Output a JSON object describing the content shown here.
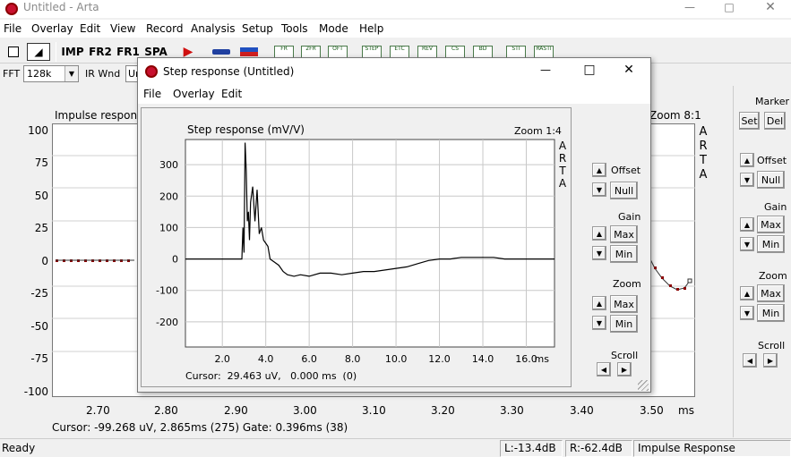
{
  "main": {
    "title": "Untitled - Arta",
    "menu": [
      "File",
      "Overlay",
      "Edit",
      "View",
      "Record",
      "Analysis",
      "Setup",
      "Tools",
      "Mode",
      "Help"
    ],
    "toolbar": {
      "imp": "IMP",
      "fr2": "FR2",
      "fr1": "FR1",
      "spa": "SPA",
      "tiny_icons": [
        "FR",
        "2FR",
        "OFT",
        "STEP",
        "ETC",
        "REV",
        "CS",
        "BD",
        "STI",
        "RASTI"
      ]
    },
    "fft_label": "FFT",
    "fft_value": "128k",
    "ir_wnd_label": "IR Wnd",
    "ir_wnd_value": "Un",
    "plot": {
      "title": "Impulse respons",
      "zoom": "Zoom 8:1",
      "arta_letters": [
        "A",
        "R",
        "T",
        "A"
      ],
      "y_ticks": [
        "100",
        "75",
        "50",
        "25",
        "0",
        "-25",
        "-50",
        "-75",
        "-100"
      ],
      "x_ticks": [
        "2.70",
        "2.80",
        "2.90",
        "3.00",
        "3.10",
        "3.20",
        "3.30",
        "3.40",
        "3.50"
      ],
      "x_unit": "ms",
      "cursor_text": "Cursor: -99.268 uV, 2.865ms (275)  Gate: 0.396ms (38)"
    },
    "right_panel": {
      "marker_label": "Marker",
      "set": "Set",
      "del": "Del",
      "offset_label": "Offset",
      "null": "Null",
      "gain_label": "Gain",
      "max": "Max",
      "min": "Min",
      "zoom_label": "Zoom",
      "zoom_max": "Max",
      "zoom_min": "Min",
      "scroll_label": "Scroll"
    },
    "status": {
      "ready": "Ready",
      "left": "L:-13.4dB",
      "right": "R:-62.4dB",
      "mode": "Impulse Response"
    }
  },
  "dialog": {
    "title": "Step response (Untitled)",
    "menu": [
      "File",
      "Overlay",
      "Edit"
    ],
    "chart_title": "Step response (mV/V)",
    "zoom": "Zoom 1:4",
    "arta_letters": [
      "A",
      "R",
      "T",
      "A"
    ],
    "cursor_text": "Cursor:  29.463 uV,   0.000 ms  (0)",
    "controls": {
      "offset_label": "Offset",
      "null": "Null",
      "gain_label": "Gain",
      "gain_max": "Max",
      "gain_min": "Min",
      "zoom_label": "Zoom",
      "zoom_max": "Max",
      "zoom_min": "Min",
      "scroll_label": "Scroll"
    }
  },
  "chart_data": [
    {
      "type": "line",
      "title": "Step response (mV/V)",
      "xlabel": "ms",
      "ylabel": "",
      "xlim": [
        0.3,
        17.3
      ],
      "ylim": [
        -280,
        380
      ],
      "x_ticks": [
        "2.0",
        "4.0",
        "6.0",
        "8.0",
        "10.0",
        "12.0",
        "14.0",
        "16.0"
      ],
      "y_ticks": [
        "300",
        "200",
        "100",
        "0",
        "-100",
        "-200"
      ],
      "grid": true,
      "series": [
        {
          "x": [
            0.3,
            2.5,
            2.9,
            2.95,
            3.0,
            3.05,
            3.1,
            3.15,
            3.2,
            3.25,
            3.3,
            3.4,
            3.5,
            3.6,
            3.7,
            3.8,
            3.9,
            4.0,
            4.1,
            4.2,
            4.4,
            4.6,
            4.8,
            5.0,
            5.3,
            5.6,
            6.0,
            6.5,
            7.0,
            7.5,
            8.0,
            8.5,
            9.0,
            9.5,
            10.0,
            10.5,
            11.0,
            11.5,
            12.0,
            12.5,
            13.0,
            13.5,
            14.0,
            14.5,
            15.0,
            15.5,
            16.0,
            16.5,
            17.3
          ],
          "y": [
            0,
            0,
            0,
            100,
            20,
            370,
            280,
            120,
            150,
            60,
            180,
            230,
            120,
            220,
            80,
            100,
            60,
            50,
            40,
            0,
            -10,
            -20,
            -40,
            -50,
            -55,
            -50,
            -55,
            -45,
            -45,
            -50,
            -45,
            -40,
            -40,
            -35,
            -30,
            -25,
            -15,
            -5,
            0,
            0,
            5,
            5,
            5,
            5,
            0,
            0,
            0,
            0,
            0
          ],
          "color": "#000000"
        }
      ]
    }
  ]
}
